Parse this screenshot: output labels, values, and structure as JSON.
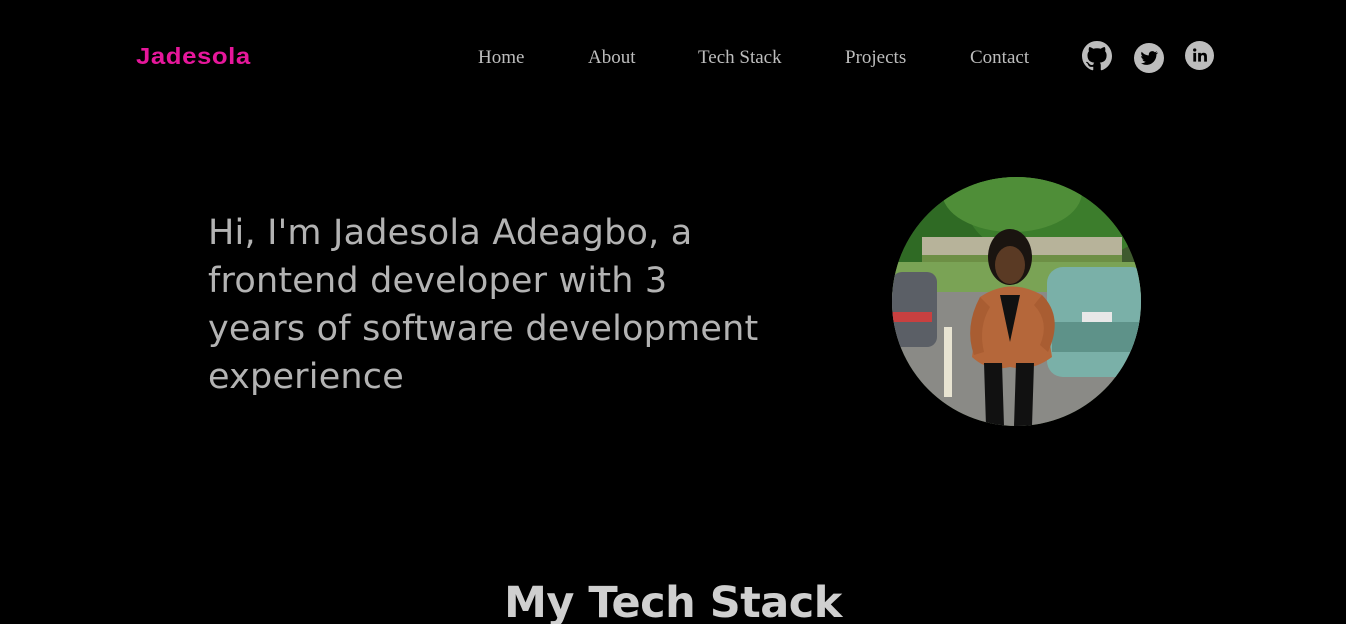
{
  "brand": {
    "name": "Jadesola",
    "color": "#e6179b"
  },
  "nav": {
    "items": [
      {
        "label": "Home"
      },
      {
        "label": "About"
      },
      {
        "label": "Tech Stack"
      },
      {
        "label": "Projects"
      },
      {
        "label": "Contact"
      }
    ]
  },
  "social": {
    "icon_color": "#bdbdbd",
    "links": [
      {
        "icon": "github-icon"
      },
      {
        "icon": "twitter-icon"
      },
      {
        "icon": "linkedin-icon"
      }
    ]
  },
  "hero": {
    "intro": "Hi, I'm Jadesola Adeagbo, a frontend developer with 3 years of software development experience",
    "photo": "profile-photo"
  },
  "tech_stack": {
    "title": "My Tech Stack"
  }
}
